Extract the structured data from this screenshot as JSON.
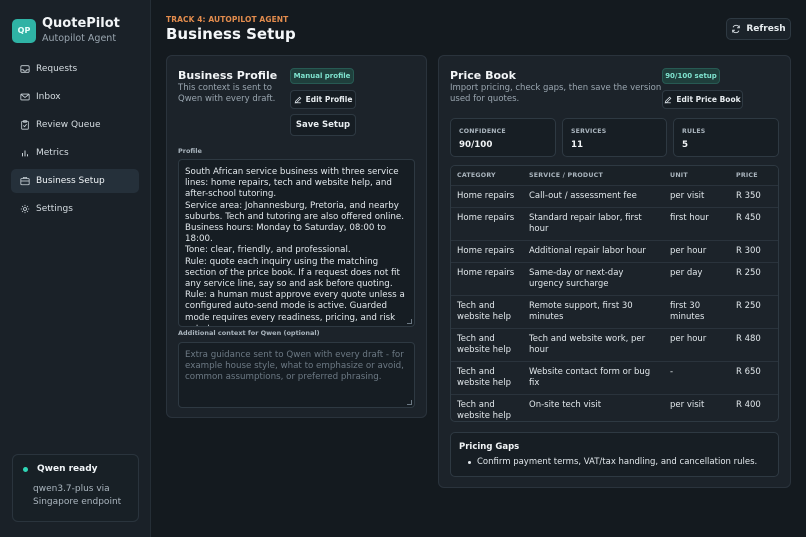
{
  "sidebar": {
    "logo": "QP",
    "app_title": "QuotePilot",
    "app_subtitle": "Autopilot Agent",
    "items": [
      {
        "label": "Requests",
        "icon": "inbox-tray-icon"
      },
      {
        "label": "Inbox",
        "icon": "mail-icon"
      },
      {
        "label": "Review Queue",
        "icon": "clipboard-check-icon"
      },
      {
        "label": "Metrics",
        "icon": "bar-chart-icon"
      },
      {
        "label": "Business Setup",
        "icon": "building-icon",
        "active": true
      },
      {
        "label": "Settings",
        "icon": "gear-icon"
      }
    ],
    "status": {
      "title": "Qwen ready",
      "line1": "qwen3.7-plus via",
      "line2": "Singapore endpoint",
      "color": "#2fd6b6"
    }
  },
  "header": {
    "eyebrow": "TRACK 4: AUTOPILOT AGENT",
    "title": "Business Setup",
    "refresh_label": "Refresh"
  },
  "profile": {
    "title": "Business Profile",
    "desc_line1": "This context is sent to",
    "desc_line2": "Qwen with every draft.",
    "badge": "Manual profile",
    "edit_label": "Edit Profile",
    "save_label": "Save Setup",
    "field_label": "Profile",
    "text": "South African service business with three service lines: home repairs, tech and website help, and after-school tutoring.\nService area: Johannesburg, Pretoria, and nearby suburbs. Tech and tutoring are also offered online.\nBusiness hours: Monday to Saturday, 08:00 to 18:00.\nTone: clear, friendly, and professional.\nRule: quote each inquiry using the matching section of the price book. If a request does not fit any service line, say so and ask before quoting.\nRule: a human must approve every quote unless a configured auto-send mode is active. Guarded mode requires every readiness, pricing, and risk gate to pass;",
    "extra_label": "Additional context for Qwen (optional)",
    "extra_placeholder": "Extra guidance sent to Qwen with every draft - for example house style, what to emphasize or avoid, common assumptions, or preferred phrasing."
  },
  "pricebook": {
    "title": "Price Book",
    "desc_line1": "Import pricing, check gaps, then save the version",
    "desc_line2": "used for quotes.",
    "badge": "90/100 setup",
    "edit_label": "Edit Price Book",
    "stats": [
      {
        "label": "CONFIDENCE",
        "value": "90/100"
      },
      {
        "label": "SERVICES",
        "value": "11"
      },
      {
        "label": "RULES",
        "value": "5"
      }
    ],
    "columns": [
      "CATEGORY",
      "SERVICE / PRODUCT",
      "UNIT",
      "PRICE"
    ],
    "rows": [
      [
        "Home repairs",
        "Call-out / assessment fee",
        "per visit",
        "R 350"
      ],
      [
        "Home repairs",
        "Standard repair labor, first hour",
        "first hour",
        "R 450"
      ],
      [
        "Home repairs",
        "Additional repair labor hour",
        "per hour",
        "R 300"
      ],
      [
        "Home repairs",
        "Same-day or next-day urgency surcharge",
        "per day",
        "R 250"
      ],
      [
        "Tech and website help",
        "Remote support, first 30 minutes",
        "first 30 minutes",
        "R 250"
      ],
      [
        "Tech and website help",
        "Tech and website work, per hour",
        "per hour",
        "R 480"
      ],
      [
        "Tech and website help",
        "Website contact form or bug fix",
        "-",
        "R 650"
      ],
      [
        "Tech and website help",
        "On-site tech visit",
        "per visit",
        "R 400"
      ]
    ],
    "gaps_title": "Pricing Gaps",
    "gaps": [
      "Confirm payment terms, VAT/tax handling, and cancellation rules."
    ]
  }
}
